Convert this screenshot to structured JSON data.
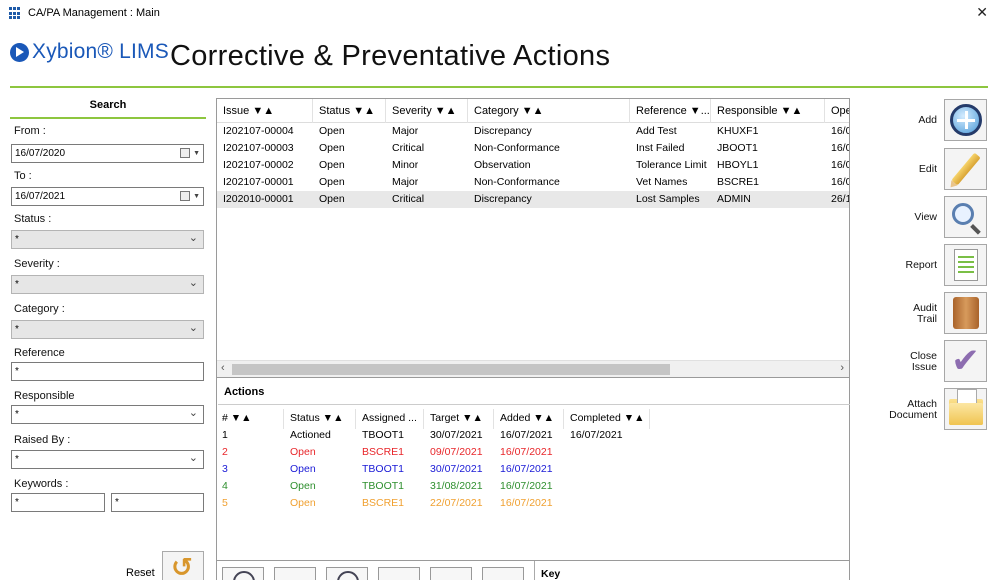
{
  "window": {
    "title": "CA/PA Management : Main",
    "close_glyph": "✕"
  },
  "header": {
    "logo_text": "Xybion® LIMS",
    "title": "Corrective & Preventative Actions"
  },
  "search": {
    "title": "Search",
    "from_label": "From :",
    "from_value": "16/07/2020",
    "to_label": "To :",
    "to_value": "16/07/2021",
    "status_label": "Status :",
    "status_value": "*",
    "severity_label": "Severity :",
    "severity_value": "*",
    "category_label": "Category :",
    "category_value": "*",
    "reference_label": "Reference",
    "reference_value": "*",
    "responsible_label": "Responsible",
    "responsible_value": "*",
    "raised_by_label": "Raised By :",
    "raised_by_value": "*",
    "keywords_label": "Keywords :",
    "keywords_value_1": "*",
    "keywords_value_2": "*",
    "reset_label": "Reset"
  },
  "issues": {
    "columns": [
      "Issue ▼▲",
      "Status ▼▲",
      "Severity ▼▲",
      "Category ▼▲",
      "Reference ▼...",
      "Responsible ▼▲",
      "Ope"
    ],
    "rows": [
      [
        "I202107-00004",
        "Open",
        "Major",
        "Discrepancy",
        "Add Test",
        "KHUXF1",
        "16/0"
      ],
      [
        "I202107-00003",
        "Open",
        "Critical",
        "Non-Conformance",
        "Inst Failed",
        "JBOOT1",
        "16/0"
      ],
      [
        "I202107-00002",
        "Open",
        "Minor",
        "Observation",
        "Tolerance Limit",
        "HBOYL1",
        "16/0"
      ],
      [
        "I202107-00001",
        "Open",
        "Major",
        "Non-Conformance",
        "Vet Names",
        "BSCRE1",
        "16/0"
      ],
      [
        "I202010-00001",
        "Open",
        "Critical",
        "Discrepancy",
        "Lost Samples",
        "ADMIN",
        "26/1"
      ]
    ],
    "selected_row": 4
  },
  "actions": {
    "title": "Actions",
    "columns": [
      "# ▼▲",
      "Status ▼▲",
      "Assigned ...",
      "Target ▼▲",
      "Added ▼▲",
      "Completed ▼▲"
    ],
    "rows": [
      [
        "1",
        "Actioned",
        "TBOOT1",
        "30/07/2021",
        "16/07/2021",
        "16/07/2021"
      ],
      [
        "2",
        "Open",
        "BSCRE1",
        "09/07/2021",
        "16/07/2021",
        ""
      ],
      [
        "3",
        "Open",
        "TBOOT1",
        "30/07/2021",
        "16/07/2021",
        ""
      ],
      [
        "4",
        "Open",
        "TBOOT1",
        "31/08/2021",
        "16/07/2021",
        ""
      ],
      [
        "5",
        "Open",
        "BSCRE1",
        "22/07/2021",
        "16/07/2021",
        ""
      ]
    ],
    "key_label": "Key"
  },
  "sidebar_buttons": {
    "add": "Add",
    "edit": "Edit",
    "view": "View",
    "report": "Report",
    "audit_1": "Audit",
    "audit_2": "Trail",
    "close_1": "Close",
    "close_2": "Issue",
    "attach_1": "Attach",
    "attach_2": "Document"
  },
  "colors": {
    "accent_green": "#8dc63f",
    "brand_blue": "#1a58b8",
    "row_1": "#000000",
    "row_2": "#e8262a",
    "row_3": "#1a1ad6",
    "row_4": "#2e8f2e",
    "row_5": "#f0a030"
  },
  "icons": [
    "app-grid-icon",
    "close-icon",
    "calendar-icon",
    "dropdown-arrow-icon",
    "reset-icon",
    "add-icon",
    "edit-pencil-icon",
    "view-magnifier-icon",
    "report-icon",
    "audit-trail-icon",
    "close-issue-check-icon",
    "attach-document-icon"
  ]
}
